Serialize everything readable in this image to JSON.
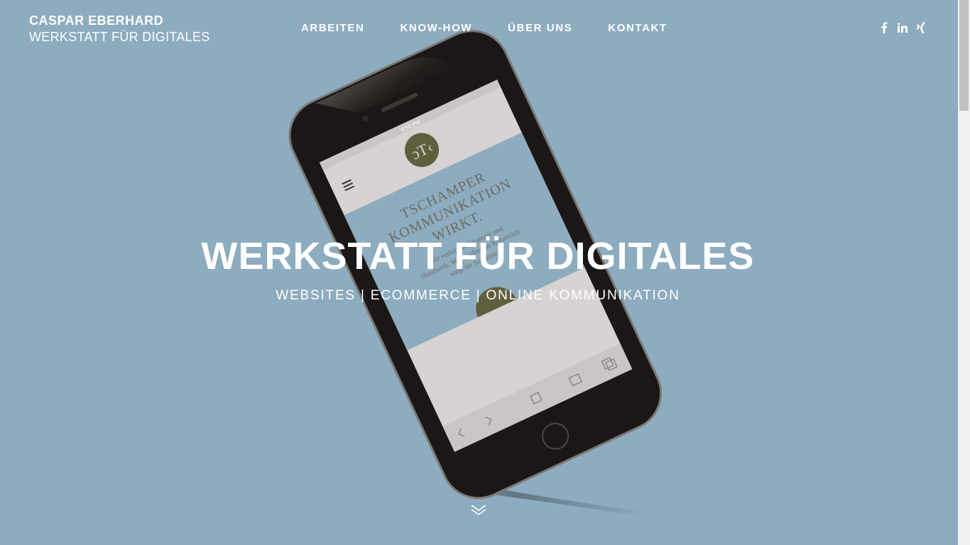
{
  "logo": {
    "line1": "CASPAR EBERHARD",
    "line2": "WERKSTATT FÜR DIGITALES"
  },
  "nav": {
    "items": [
      {
        "label": "ARBEITEN"
      },
      {
        "label": "KNOW-HOW"
      },
      {
        "label": "ÜBER UNS"
      },
      {
        "label": "KONTAKT"
      }
    ]
  },
  "social": {
    "icons": [
      "facebook-icon",
      "linkedin-icon",
      "xing-icon"
    ]
  },
  "hero": {
    "title": "WERKSTATT FÜR DIGITALES",
    "subtitle": "WEBSITES | ECOMMERCE | ONLINE KOMMUNIKATION"
  },
  "phone_screen": {
    "status_time": "4:50 PM",
    "headline_lines": [
      "TSCHAMPER",
      "KOMMUNIKATION",
      "WIRKT."
    ],
    "body_lines": [
      "Wir verbinden Strategie und",
      "Handwerk. Wir glauben an Kreativität",
      "sorgt für Substanz."
    ]
  },
  "colors": {
    "background": "#8dacbf",
    "text": "#ffffff",
    "phone_body": "#1a1716",
    "badge": "#5f5f3e"
  },
  "scroll_down_icon": "double-chevron-down-icon"
}
